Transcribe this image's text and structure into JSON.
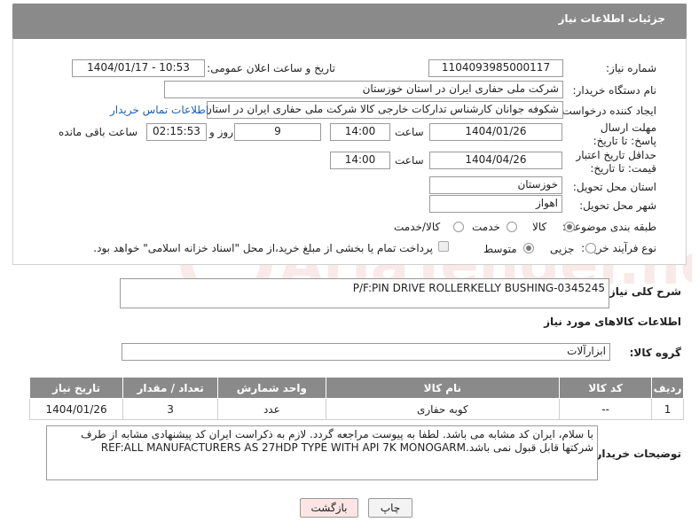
{
  "header": {
    "title": "جزئیات اطلاعات نیاز"
  },
  "need_number": {
    "label": "شماره نیاز:",
    "value": "1104093985000117"
  },
  "announce": {
    "label": "تاریخ و ساعت اعلان عمومی:",
    "value": "1404/01/17 - 10:53"
  },
  "buyer_org": {
    "label": "نام دستگاه خریدار:",
    "value": "شرکت ملی حفاری ایران در استان خوزستان"
  },
  "requester": {
    "label": "ایجاد کننده درخواست:",
    "value": "شکوفه جوانان کارشناس تدارکات خارجی کالا شرکت ملی حفاری ایران در استان",
    "contact_link": "اطلاعات تماس خریدار"
  },
  "deadline": {
    "label": "مهلت ارسال پاسخ: تا تاریخ:",
    "date": "1404/01/26",
    "time_label": "ساعت",
    "time": "14:00",
    "days": "9",
    "days_label": "روز و",
    "remaining": "02:15:53",
    "remaining_label": "ساعت باقی مانده"
  },
  "price_validity": {
    "label": "حداقل تاریخ اعتبار قیمت: تا تاریخ:",
    "date": "1404/04/26",
    "time_label": "ساعت",
    "time": "14:00"
  },
  "province": {
    "label": "استان محل تحویل:",
    "value": "خوزستان"
  },
  "city": {
    "label": "شهر محل تحویل:",
    "value": "اهواز"
  },
  "category": {
    "label": "طبقه بندی موضوعی:",
    "options": [
      "کالا",
      "خدمت",
      "کالا/خدمت"
    ]
  },
  "process": {
    "label": "نوع فرآیند خرید :",
    "options": [
      "جزیی",
      "متوسط"
    ],
    "payment_text": "پرداخت تمام یا بخشی از مبلغ خرید،از محل \"اسناد خزانه اسلامی\" خواهد بود."
  },
  "description": {
    "label": "شرح کلی نیاز:",
    "value": "P/F:PIN DRIVE ROLLERKELLY BUSHING-0345245"
  },
  "items_info": {
    "title": "اطلاعات کالاهای مورد نیاز"
  },
  "goods_group": {
    "label": "گروه کالا:",
    "value": "ابزارآلات"
  },
  "table": {
    "headers": [
      "ردیف",
      "کد کالا",
      "نام کالا",
      "واحد شمارش",
      "تعداد / مقدار",
      "تاریخ نیاز"
    ],
    "rows": [
      {
        "row": "1",
        "code": "--",
        "name": "کوبه حفاری",
        "unit": "عدد",
        "qty": "3",
        "date": "1404/01/26"
      }
    ]
  },
  "buyer_notes": {
    "label": "توضیحات خریدار:",
    "line1": "با سلام، ایران کد مشابه می باشد. لطفا به پیوست مراجعه گردد. لازم به ذکراست ایران کد پیشنهادی مشابه از طرف",
    "line2": "شرکتها قابل قبول نمی باشد.REF:ALL MANUFACTURERS AS 27HDP TYPE WITH API 7K MONOGARM"
  },
  "buttons": {
    "print": "چاپ",
    "back": "بازگشت"
  },
  "watermark": {
    "text": "AriaTender.net"
  },
  "colors": {
    "header_bg": "#8a8a8a",
    "link": "#1a5fb4",
    "back_btn": "#fde5e5"
  }
}
